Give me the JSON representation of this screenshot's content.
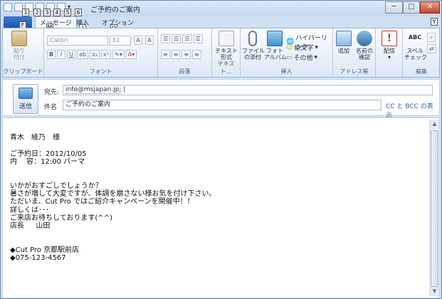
{
  "window": {
    "title": "ご予約のご案内",
    "controls": {
      "minimize": "─",
      "maximize": "□",
      "close": "✕"
    }
  },
  "keytips": {
    "qat": [
      "1",
      "2",
      "3",
      "4",
      "5",
      "6"
    ],
    "file": "F",
    "message": "M",
    "insert": "I",
    "options": "O",
    "help": "Y"
  },
  "tabs": {
    "message": "メッセージ",
    "insert": "挿入",
    "options": "オプション"
  },
  "ribbon": {
    "clipboard": {
      "label": "クリップボード",
      "paste": "貼り\n付け"
    },
    "font": {
      "label": "フォント",
      "font_name": "Calibri",
      "font_size": "12"
    },
    "paragraph": {
      "label": "段落"
    },
    "text": {
      "label": "テキスト...",
      "text_format": "テキスト\n形式"
    },
    "insert": {
      "label": "挿入",
      "attach_file": "ファイル\nの添付",
      "photo_album": "フォト\nアルバム",
      "hyperlink": "ハイパーリンク",
      "emoticon": "絵文字",
      "other": "その他"
    },
    "address": {
      "label": "アドレス帳",
      "add": "追加",
      "check_names": "名前の\n確認"
    },
    "priority": {
      "label": "配信"
    },
    "editing": {
      "label": "編集",
      "spell_check": "スペル\nチェック"
    }
  },
  "header": {
    "send_label": "送信",
    "to_label": "宛先:",
    "to_value": "info@msjapan.jp;",
    "subject_label": "件名",
    "subject_value": "ご予約のご案内",
    "cc_bcc_link": "CC と BCC の表示"
  },
  "body": {
    "text": "青木　綾乃　様\n\nご予約日：2012/10/05\n内　 容：12:00 パーマ\n\n\nいかがおすごしでしょうか？\n暑さが増して大変ですが、体調を崩さない様お気を付け下さい。\nただいま、Cut Pro ではご紹介キャンペーンを開催中！！\n詳しくは･･･\nご来店お待ちしております(^^)\n店長　  山田\n\n\n◆Cut Pro 京都駅前店\n◆075-123-4567"
  }
}
